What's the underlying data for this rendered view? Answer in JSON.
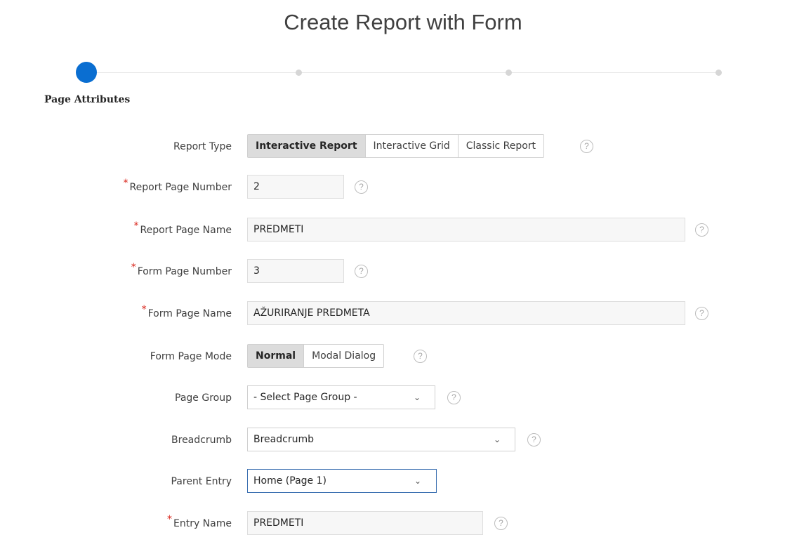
{
  "title": "Create Report with Form",
  "wizard": {
    "current_step_label": "Page Attributes"
  },
  "icons": {
    "help": "?",
    "chevron": "⌄"
  },
  "fields": {
    "report_type": {
      "label": "Report Type",
      "options": [
        "Interactive Report",
        "Interactive Grid",
        "Classic Report"
      ],
      "selected": "Interactive Report"
    },
    "report_page_number": {
      "label": "Report Page Number",
      "value": "2",
      "required": "*"
    },
    "report_page_name": {
      "label": "Report Page Name",
      "value": "PREDMETI",
      "required": "*"
    },
    "form_page_number": {
      "label": "Form Page Number",
      "value": "3",
      "required": "*"
    },
    "form_page_name": {
      "label": "Form Page Name",
      "value": "AŽURIRANJE PREDMETA",
      "required": "*"
    },
    "form_page_mode": {
      "label": "Form Page Mode",
      "options": [
        "Normal",
        "Modal Dialog"
      ],
      "selected": "Normal"
    },
    "page_group": {
      "label": "Page Group",
      "value": "- Select Page Group -"
    },
    "breadcrumb": {
      "label": "Breadcrumb",
      "value": "Breadcrumb"
    },
    "parent_entry": {
      "label": "Parent Entry",
      "value": "Home (Page 1)"
    },
    "entry_name": {
      "label": "Entry Name",
      "value": "PREDMETI",
      "required": "*"
    }
  },
  "colors": {
    "accent": "#0a6ed1",
    "required": "#d9261c",
    "focus_border": "#3a6fb0"
  }
}
